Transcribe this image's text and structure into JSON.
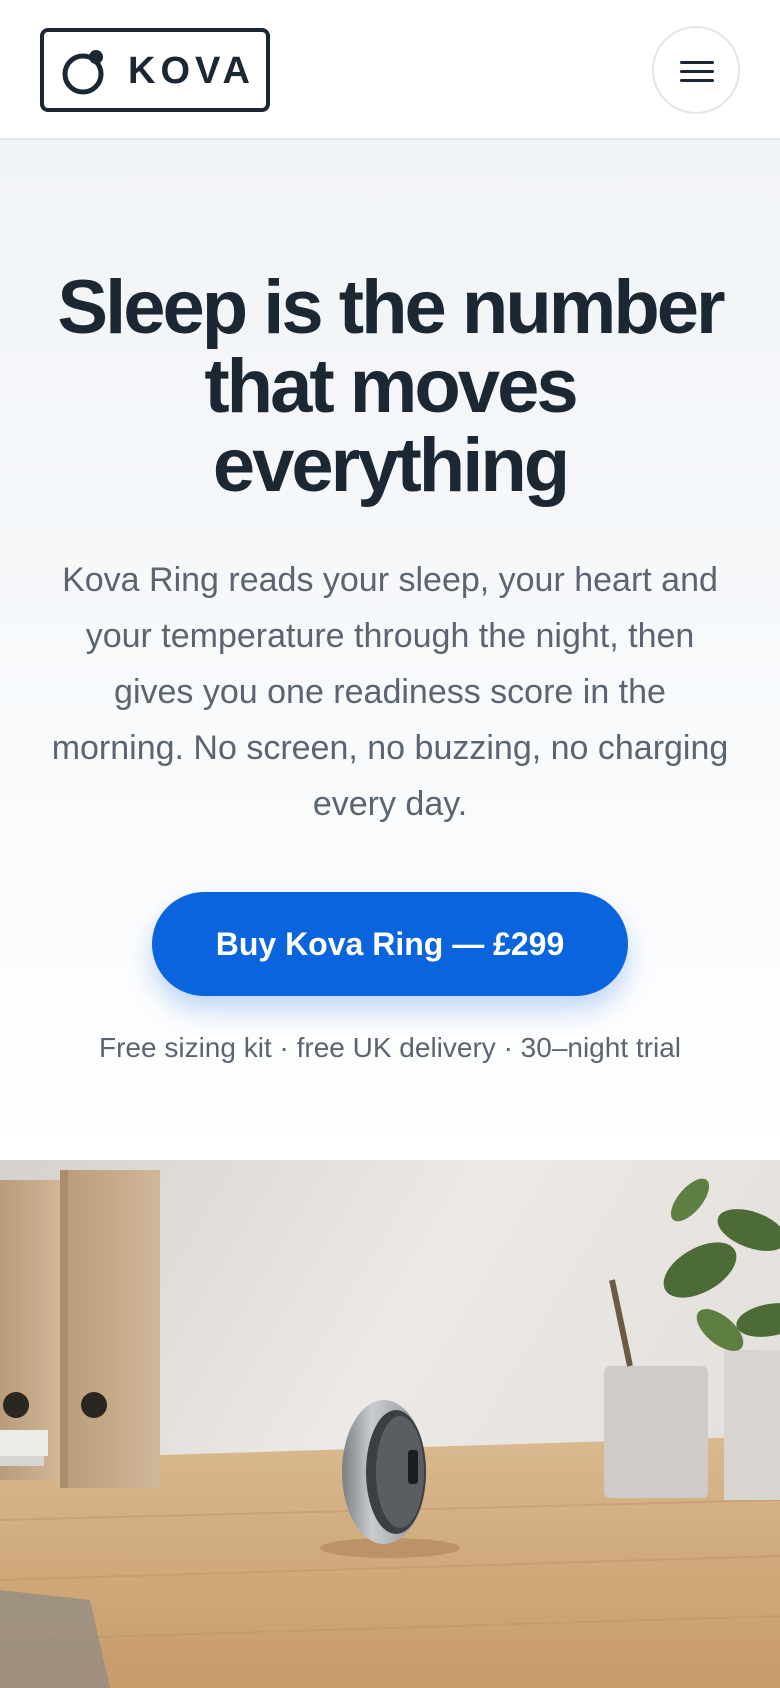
{
  "header": {
    "brand": "KOVA",
    "logo_icon": "ring-logo-icon",
    "menu_icon": "hamburger-menu-icon"
  },
  "hero": {
    "headline": "Sleep is the number that moves everything",
    "body": "Kova Ring reads your sleep, your heart and your temperature through the night, then gives you one readiness score in the morning. No screen, no buzzing, no charging every day.",
    "cta_label": "Buy Kova Ring — £299",
    "note": "Free sizing kit · free UK delivery · 30–night trial"
  },
  "image": {
    "description_icon": "product-photo-ring-on-desk"
  },
  "colors": {
    "accent": "#0a64de",
    "text_dark": "#1b2733",
    "text_muted": "#5b6572",
    "hero_bg": "#f1f4f7"
  }
}
